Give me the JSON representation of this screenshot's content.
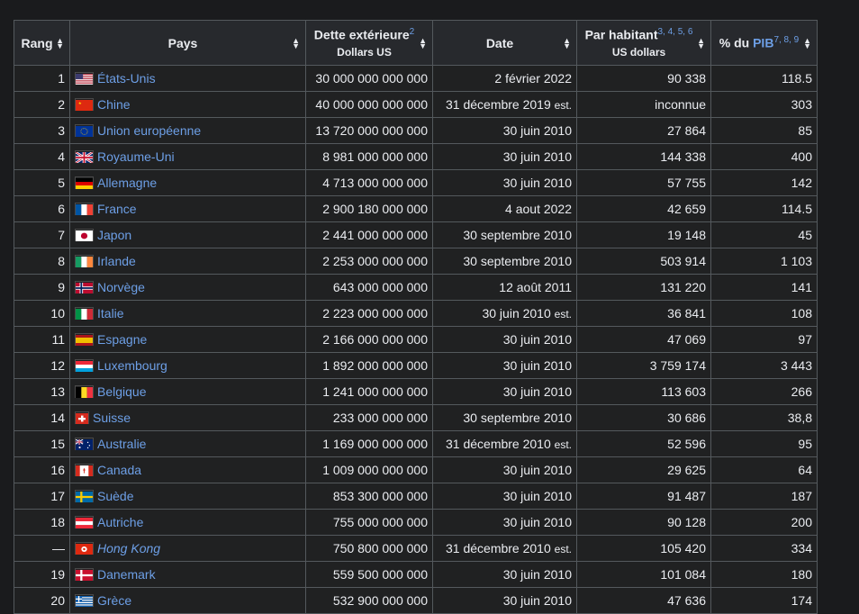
{
  "headers": {
    "rang": "Rang",
    "pays": "Pays",
    "dette": "Dette extérieure",
    "dette_ref": "2",
    "dette_sub": "Dollars US",
    "date": "Date",
    "par_habitant": "Par habitant",
    "par_habitant_ref": "3, 4, 5, 6",
    "par_habitant_sub": "US dollars",
    "pib_prefix": "% du ",
    "pib_link": "PIB",
    "pib_ref": "7, 8, 9"
  },
  "est_label": "est.",
  "rows": [
    {
      "rank": "1",
      "country": "États-Unis",
      "flag": "us",
      "debt": "30 000 000 000 000",
      "date": "2 février 2022",
      "est": false,
      "per_capita": "90 338",
      "gdp": "118.5"
    },
    {
      "rank": "2",
      "country": "Chine",
      "flag": "cn",
      "debt": "40 000 000 000 000",
      "date": "31 décembre 2019",
      "est": true,
      "per_capita": "inconnue",
      "gdp": "303"
    },
    {
      "rank": "3",
      "country": "Union européenne",
      "flag": "eu",
      "debt": "13 720 000 000 000",
      "date": "30 juin 2010",
      "est": false,
      "per_capita": "27 864",
      "gdp": "85"
    },
    {
      "rank": "4",
      "country": "Royaume-Uni",
      "flag": "uk",
      "debt": "8 981 000 000 000",
      "date": "30 juin 2010",
      "est": false,
      "per_capita": "144 338",
      "gdp": "400"
    },
    {
      "rank": "5",
      "country": "Allemagne",
      "flag": "de",
      "debt": "4 713 000 000 000",
      "date": "30 juin 2010",
      "est": false,
      "per_capita": "57 755",
      "gdp": "142"
    },
    {
      "rank": "6",
      "country": "France",
      "flag": "fr",
      "debt": "2 900 180 000 000",
      "date": "4 aout 2022",
      "est": false,
      "per_capita": "42 659",
      "gdp": "114.5"
    },
    {
      "rank": "7",
      "country": "Japon",
      "flag": "jp",
      "debt": "2 441 000 000 000",
      "date": "30 septembre 2010",
      "est": false,
      "per_capita": "19 148",
      "gdp": "45"
    },
    {
      "rank": "8",
      "country": "Irlande",
      "flag": "ie",
      "debt": "2 253 000 000 000",
      "date": "30 septembre 2010",
      "est": false,
      "per_capita": "503 914",
      "gdp": "1 103"
    },
    {
      "rank": "9",
      "country": "Norvège",
      "flag": "no",
      "debt": "643 000 000 000",
      "date": "12 août 2011",
      "est": false,
      "per_capita": "131 220",
      "gdp": "141"
    },
    {
      "rank": "10",
      "country": "Italie",
      "flag": "it",
      "debt": "2 223 000 000 000",
      "date": "30 juin 2010",
      "est": true,
      "per_capita": "36 841",
      "gdp": "108"
    },
    {
      "rank": "11",
      "country": "Espagne",
      "flag": "es",
      "debt": "2 166 000 000 000",
      "date": "30 juin 2010",
      "est": false,
      "per_capita": "47 069",
      "gdp": "97"
    },
    {
      "rank": "12",
      "country": "Luxembourg",
      "flag": "lu",
      "debt": "1 892 000 000 000",
      "date": "30 juin 2010",
      "est": false,
      "per_capita": "3 759 174",
      "gdp": "3 443"
    },
    {
      "rank": "13",
      "country": "Belgique",
      "flag": "be",
      "debt": "1 241 000 000 000",
      "date": "30 juin 2010",
      "est": false,
      "per_capita": "113 603",
      "gdp": "266"
    },
    {
      "rank": "14",
      "country": "Suisse",
      "flag": "ch",
      "debt": "233 000 000 000",
      "date": "30 septembre 2010",
      "est": false,
      "per_capita": "30 686",
      "gdp": "38,8"
    },
    {
      "rank": "15",
      "country": "Australie",
      "flag": "au",
      "debt": "1 169 000 000 000",
      "date": "31 décembre 2010",
      "est": true,
      "per_capita": "52 596",
      "gdp": "95"
    },
    {
      "rank": "16",
      "country": "Canada",
      "flag": "ca",
      "debt": "1 009 000 000 000",
      "date": "30 juin 2010",
      "est": false,
      "per_capita": "29 625",
      "gdp": "64"
    },
    {
      "rank": "17",
      "country": "Suède",
      "flag": "se",
      "debt": "853 300 000 000",
      "date": "30 juin 2010",
      "est": false,
      "per_capita": "91 487",
      "gdp": "187"
    },
    {
      "rank": "18",
      "country": "Autriche",
      "flag": "at",
      "debt": "755 000 000 000",
      "date": "30 juin 2010",
      "est": false,
      "per_capita": "90 128",
      "gdp": "200"
    },
    {
      "rank": "—",
      "country": "Hong Kong",
      "flag": "hk",
      "italic": true,
      "debt": "750 800 000 000",
      "date": "31 décembre 2010",
      "est": true,
      "per_capita": "105 420",
      "gdp": "334"
    },
    {
      "rank": "19",
      "country": "Danemark",
      "flag": "dk",
      "debt": "559 500 000 000",
      "date": "30 juin 2010",
      "est": false,
      "per_capita": "101 084",
      "gdp": "180"
    },
    {
      "rank": "20",
      "country": "Grèce",
      "flag": "gr",
      "debt": "532 900 000 000",
      "date": "30 juin 2010",
      "est": false,
      "per_capita": "47 636",
      "gdp": "174"
    }
  ]
}
